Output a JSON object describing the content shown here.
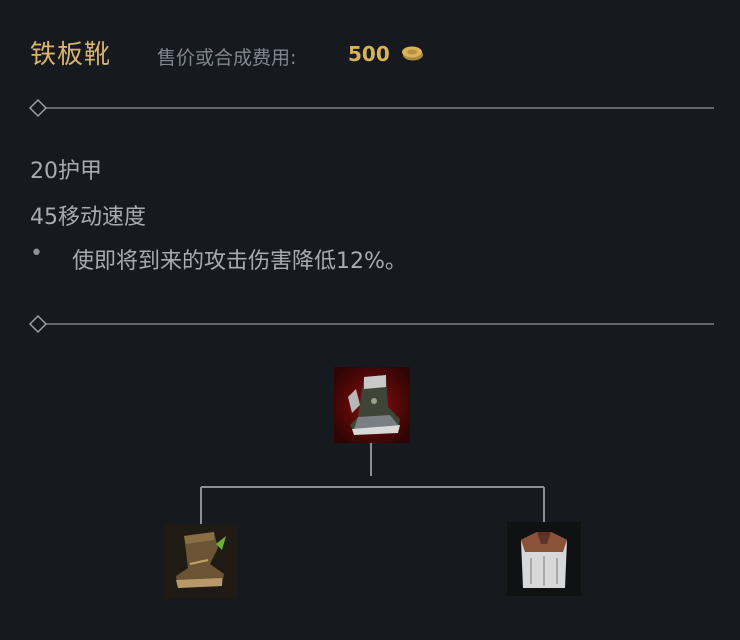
{
  "item": {
    "name": "铁板靴",
    "cost_label": "售价或合成费用:",
    "cost_value": "500",
    "stats": [
      "20护甲",
      "45移动速度"
    ],
    "passive_bullet": "•",
    "passive_text": "使即将到来的攻击伤害降低12%。"
  },
  "recipe": {
    "result_icon": "plated-steelcaps-icon",
    "components": [
      "boots-icon",
      "cloth-armor-icon"
    ]
  },
  "colors": {
    "title": "#d7b36f",
    "gold": "#d9b25a",
    "text": "#a7acb2",
    "muted": "#7f8790",
    "background": "#16191d",
    "line": "#7c8289"
  }
}
